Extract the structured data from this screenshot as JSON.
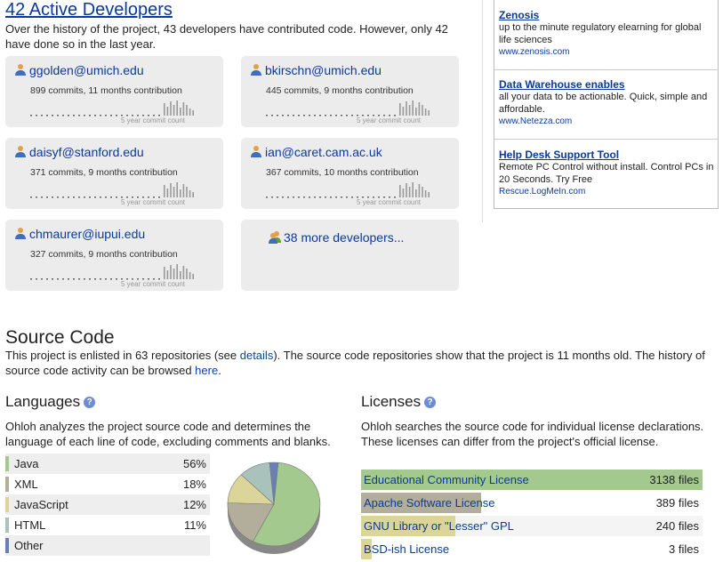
{
  "developers_section": {
    "title": "42 Active Developers",
    "intro": "Over the history of the project, 43 developers have contributed code. However, only 42 have done so in the last year.",
    "spark_label": "5 year commit count",
    "developers": [
      {
        "email": "ggolden@umich.edu",
        "stats": "899 commits, 11 months contribution"
      },
      {
        "email": "bkirschn@umich.edu",
        "stats": "445 commits, 9 months contribution"
      },
      {
        "email": "daisyf@stanford.edu",
        "stats": "371 commits, 9 months contribution"
      },
      {
        "email": "ian@caret.cam.ac.uk",
        "stats": "367 commits, 10 months contribution"
      },
      {
        "email": "chmaurer@iupui.edu",
        "stats": "327 commits, 9 months contribution"
      }
    ],
    "more_link": "38 more developers..."
  },
  "ads": [
    {
      "heading": "Zenosis",
      "body": "up to the minute regulatory elearning for global life sciences",
      "url": "www.zenosis.com"
    },
    {
      "heading": "Data Warehouse enables",
      "body": "all your data to be actionable. Quick, simple and affordable.",
      "url": "www.Netezza.com"
    },
    {
      "heading": "Help Desk Support Tool",
      "body": "Remote PC Control without install. Control PCs in 20 Seconds. Try Free",
      "url": "Rescue.LogMeIn.com"
    }
  ],
  "source_code": {
    "title": "Source Code",
    "text_1": "This project is enlisted in 63 repositories (see ",
    "details_link": "details",
    "text_2": "). The source code repositories show that the project is 11 months old. The history of source code activity can be browsed ",
    "here_link": "here",
    "text_3": "."
  },
  "languages": {
    "title": "Languages",
    "help": "?",
    "desc": "Ohloh analyzes the project source code and determines the language of each line of code, excluding comments and blanks.",
    "rows": [
      {
        "name": "Java",
        "pct": "56%",
        "value": 56,
        "color": "#a3c98e"
      },
      {
        "name": "XML",
        "pct": "18%",
        "value": 18,
        "color": "#b3ad9b"
      },
      {
        "name": "JavaScript",
        "pct": "12%",
        "value": 12,
        "color": "#dbd59a"
      },
      {
        "name": "HTML",
        "pct": "11%",
        "value": 11,
        "color": "#a9c3bc"
      },
      {
        "name": "Other",
        "pct": "",
        "value": 3,
        "color": "#6a7fb5"
      }
    ]
  },
  "licenses": {
    "title": "Licenses",
    "help": "?",
    "desc": "Ohloh searches the source code for individual license declarations. These licenses can differ from the project's official license.",
    "rows": [
      {
        "name": "Educational Community License",
        "count": "3138 files",
        "value": 3138
      },
      {
        "name": "Apache Software License",
        "count": "389 files",
        "value": 389
      },
      {
        "name": "GNU Library or \"Lesser\" GPL",
        "count": "240 files",
        "value": 240
      },
      {
        "name": "BSD-ish License",
        "count": "3 files",
        "value": 3
      }
    ]
  }
}
